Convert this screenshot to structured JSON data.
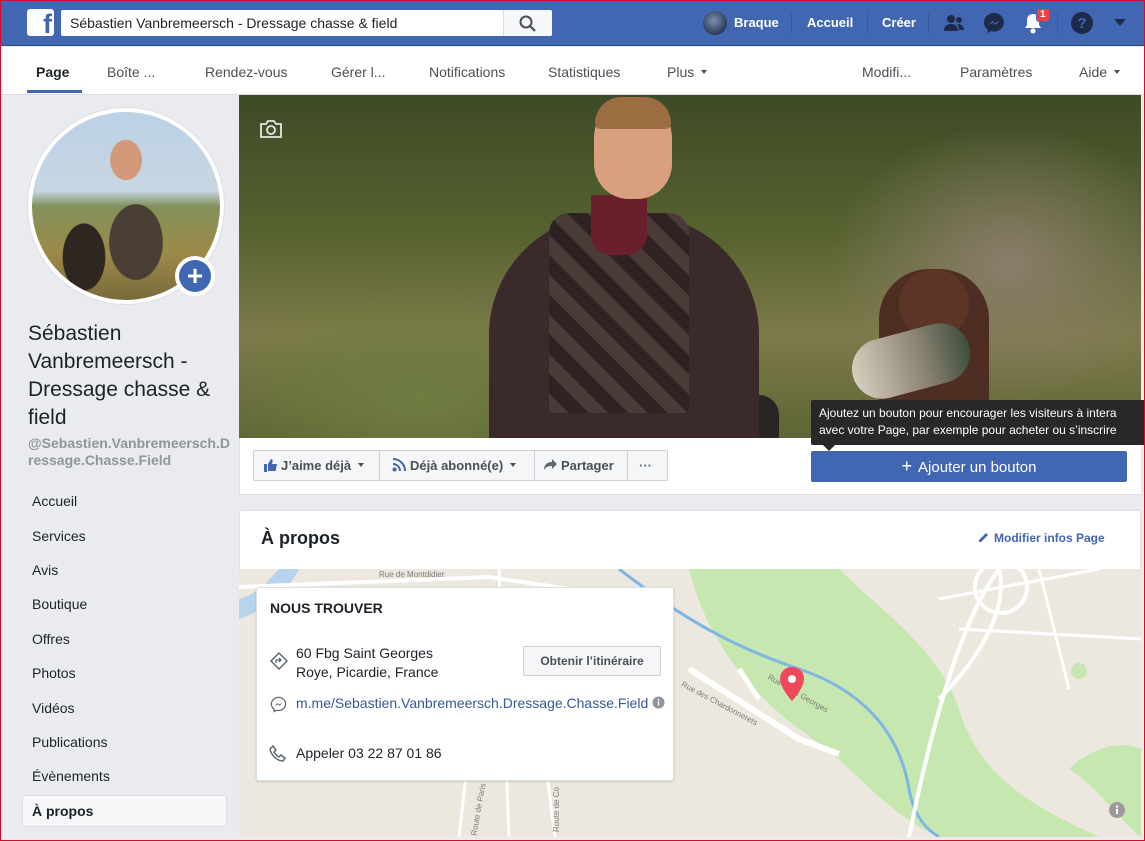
{
  "topbar": {
    "search_value": "Sébastien Vanbremeersch - Dressage chasse & field",
    "user_name": "Braque",
    "home": "Accueil",
    "create": "Créer",
    "notifications_count": "1"
  },
  "tabs": {
    "page": "Page",
    "inbox": "Boîte ...",
    "appointments": "Rendez-vous",
    "manage": "Gérer l...",
    "notifications": "Notifications",
    "insights": "Statistiques",
    "more": "Plus",
    "edit": "Modifi...",
    "settings": "Paramètres",
    "help": "Aide"
  },
  "page": {
    "name": "Sébastien Vanbremeersch - Dressage chasse & field",
    "handle": "@Sebastien.Vanbremeersch.Dressage.Chasse.Field"
  },
  "nav": {
    "items": [
      "Accueil",
      "Services",
      "Avis",
      "Boutique",
      "Offres",
      "Photos",
      "Vidéos",
      "Publications",
      "Évènements",
      "À propos"
    ]
  },
  "actions": {
    "liked": "J’aime déjà",
    "subscribed": "Déjà abonné(e)",
    "share": "Partager",
    "more": "···",
    "add_button": "Ajouter un bouton",
    "tooltip_line1": "Ajoutez un bouton pour encourager les visiteurs à intera",
    "tooltip_line2": "avec votre Page, par exemple pour acheter ou s’inscrire"
  },
  "about": {
    "title": "À propos",
    "edit_link": "Modifier infos Page",
    "find_us": "NOUS TROUVER",
    "address_line1": "60 Fbg Saint Georges",
    "address_line2": "Roye, Picardie, France",
    "directions_button": "Obtenir l’itinéraire",
    "messenger_link": "m.me/Sebastien.Vanbremeersch.Dressage.Chasse.Field",
    "call": "Appeler 03 22 87 01 86"
  },
  "map": {
    "streets": [
      "Rue de Montdidier",
      "Rue Saint Georges",
      "Rue des Chardonnerets",
      "Route de Paris",
      "Route de Co"
    ]
  },
  "colors": {
    "brand": "#4267b2",
    "tooltip": "#282828",
    "map_green": "#c6e8b0",
    "marker": "#f0475c"
  }
}
